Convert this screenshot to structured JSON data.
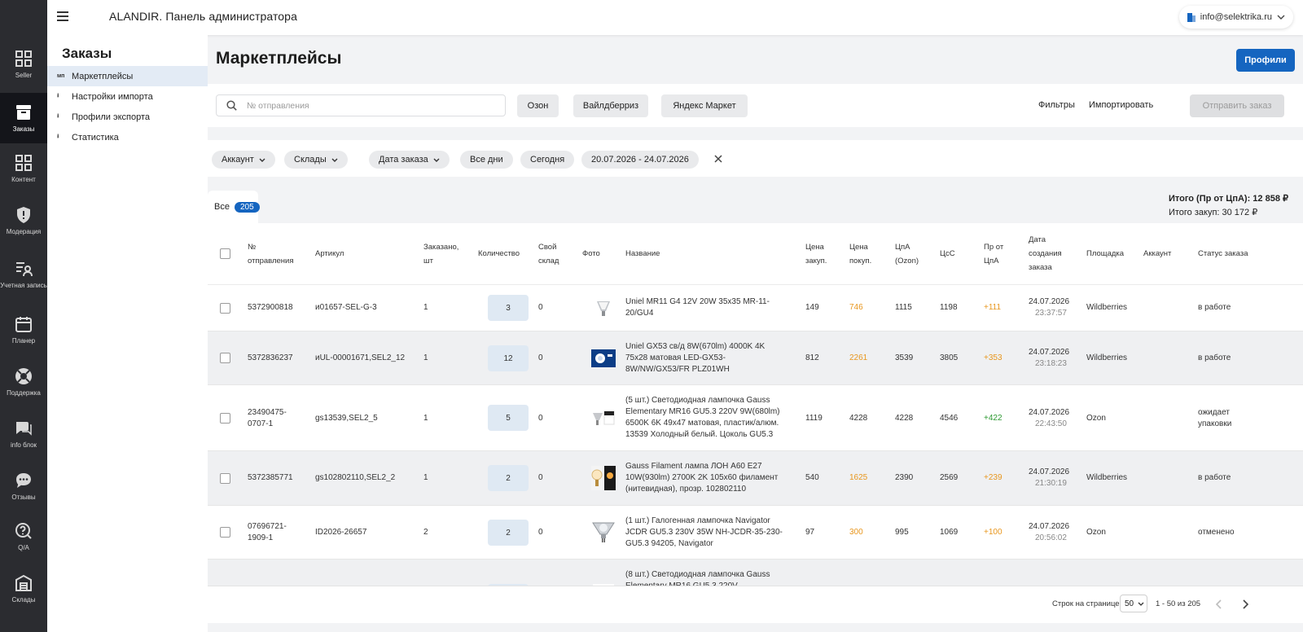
{
  "app": {
    "title": "ALANDIR. Панель администратора",
    "user_email": "info@selektrika.ru"
  },
  "rail": [
    {
      "label": "Seller",
      "icon": "dashboard-icon"
    },
    {
      "label": "Заказы",
      "icon": "box-icon",
      "active": true
    },
    {
      "label": "Контент",
      "icon": "content-icon"
    },
    {
      "label": "Модерация",
      "icon": "shield-icon"
    },
    {
      "label": "Учетная запись",
      "icon": "user-list-icon"
    },
    {
      "label": "Планер",
      "icon": "calendar-icon"
    },
    {
      "label": "Поддержка",
      "icon": "lifebuoy-icon"
    },
    {
      "label": "info блок",
      "icon": "chat-icon"
    },
    {
      "label": "Отзывы",
      "icon": "feedback-icon"
    },
    {
      "label": "Q/A",
      "icon": "question-icon"
    },
    {
      "label": "Склады",
      "icon": "warehouse-icon"
    }
  ],
  "sidebar": {
    "title": "Заказы",
    "items": [
      {
        "icon_text": "мп",
        "label": "Маркетплейсы",
        "active": true
      },
      {
        "icon_text": "⭳",
        "label": "Настройки импорта"
      },
      {
        "icon_text": "⭳",
        "label": "Профили экспорта"
      },
      {
        "icon_text": "⭳",
        "label": "Статистика"
      }
    ]
  },
  "page": {
    "title": "Маркетплейсы",
    "profiles_button": "Профили"
  },
  "toolbar": {
    "search_placeholder": "№ отправления",
    "marketplaces": [
      "Озон",
      "Вайлдберриз",
      "Яндекс Маркет"
    ],
    "filters": "Фильтры",
    "import": "Импортировать",
    "send_order": "Отправить заказ"
  },
  "filterbar": {
    "account": "Аккаунт",
    "warehouses": "Склады",
    "order_date": "Дата заказа",
    "all_days": "Все дни",
    "today": "Сегодня",
    "date_range": "20.07.2026 - 24.07.2026"
  },
  "tabs": {
    "all_label": "Все",
    "all_count": "205"
  },
  "totals": {
    "line1": "Итого (Пр от ЦпА): 12 858 ₽",
    "line2": "Итого закуп: 30 172 ₽"
  },
  "table": {
    "headers": {
      "shipment": "№ отправления",
      "article": "Артикул",
      "ordered": "Заказано, шт",
      "quantity": "Количество",
      "own_stock": "Свой склад",
      "photo": "Фото",
      "name": "Название",
      "buy_price": "Цена закуп.",
      "sell_price": "Цена покуп.",
      "cpa": "ЦпА (Ozon)",
      "cps": "ЦсС",
      "profit": "Пр от ЦпА",
      "created": "Дата создания заказа",
      "platform": "Площадка",
      "account": "Аккаунт",
      "status": "Статус заказа"
    },
    "rows": [
      {
        "shipment": "5372900818",
        "article": "и01657-SEL-G-3",
        "ordered": "1",
        "quantity": "3",
        "own_stock": "0",
        "photo": "bulb-mr11-image",
        "name": "Uniel MR11 G4 12V 20W 35x35 MR-11-20/GU4",
        "buy_price": "149",
        "sell_price": "746",
        "sell_orange": true,
        "cpa": "1115",
        "cps": "1198",
        "profit": "+111",
        "profit_color": "orange",
        "date": "24.07.2026",
        "time": "23:37:57",
        "platform": "Wildberries",
        "status": "в работе"
      },
      {
        "shipment": "5372836237",
        "article": "иUL-00001671,SEL2_12",
        "ordered": "1",
        "quantity": "12",
        "own_stock": "0",
        "photo": "gx53-lamp-image",
        "name": "Uniel GX53 св/д 8W(670lm) 4000K 4K 75x28 матовая LED-GX53-8W/NW/GX53/FR PLZ01WH",
        "buy_price": "812",
        "sell_price": "2261",
        "sell_orange": true,
        "cpa": "3539",
        "cps": "3805",
        "profit": "+353",
        "profit_color": "orange",
        "date": "24.07.2026",
        "time": "23:18:23",
        "platform": "Wildberries",
        "status": "в работе"
      },
      {
        "shipment": "23490475-0707-1",
        "article": "gs13539,SEL2_5",
        "ordered": "1",
        "quantity": "5",
        "own_stock": "0",
        "photo": "gauss-mr16-image",
        "name": "(5 шт.) Светодиодная лампочка Gauss Elementary MR16 GU5.3 220V 9W(680lm) 6500K 6K 49x47 матовая, пластик/алюм. 13539 Холодный белый. Цоколь GU5.3",
        "buy_price": "1119",
        "sell_price": "4228",
        "sell_orange": false,
        "cpa": "4228",
        "cps": "4546",
        "profit": "+422",
        "profit_color": "green",
        "date": "24.07.2026",
        "time": "22:43:50",
        "platform": "Ozon",
        "status": "ожидает упаковки"
      },
      {
        "shipment": "5372385771",
        "article": "gs102802110,SEL2_2",
        "ordered": "1",
        "quantity": "2",
        "own_stock": "0",
        "photo": "filament-bulb-image",
        "name": "Gauss Filament лампа ЛОН A60 E27 10W(930lm) 2700K 2K 105x60 филамент (нитевидная), прозр. 102802110",
        "buy_price": "540",
        "sell_price": "1625",
        "sell_orange": true,
        "cpa": "2390",
        "cps": "2569",
        "profit": "+239",
        "profit_color": "orange",
        "date": "24.07.2026",
        "time": "21:30:19",
        "platform": "Wildberries",
        "status": "в работе"
      },
      {
        "shipment": "07696721-1909-1",
        "article": "ID2026-26657",
        "ordered": "2",
        "quantity": "2",
        "own_stock": "0",
        "photo": "halogen-jcdr-image",
        "name": "(1 шт.) Галогенная лампочка Navigator JCDR GU5.3 230V 35W NH-JCDR-35-230-GU5.3 94205, Navigator",
        "buy_price": "97",
        "sell_price": "300",
        "sell_orange": true,
        "cpa": "995",
        "cps": "1069",
        "profit": "+100",
        "profit_color": "orange",
        "date": "24.07.2026",
        "time": "20:56:02",
        "platform": "Ozon",
        "status": "отменено"
      },
      {
        "shipment": "",
        "article": "",
        "ordered": "",
        "quantity": "",
        "own_stock": "",
        "photo": "bulb-partial-image",
        "name": "(8 шт.) Светодиодная лампочка Gauss Elementary MR16 GU5.3 220V",
        "buy_price": "",
        "sell_price": "",
        "sell_orange": false,
        "cpa": "",
        "cps": "",
        "profit": "",
        "profit_color": "orange",
        "date": "",
        "time": "",
        "platform": "",
        "status": ""
      }
    ]
  },
  "pagination": {
    "rows_per_page_label": "Строк на странице",
    "rows_per_page": "50",
    "range": "1 - 50 из 205"
  },
  "colors": {
    "primary": "#1565c0",
    "rail_bg": "#2b2c30",
    "orange": "#e8961d",
    "green": "#2e9a33"
  }
}
